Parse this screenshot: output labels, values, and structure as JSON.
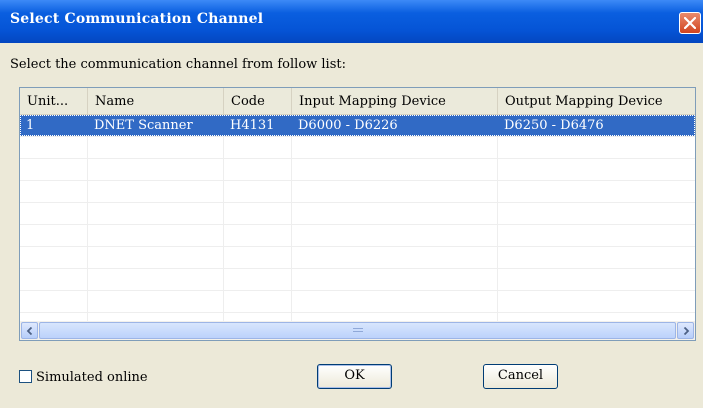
{
  "window": {
    "title": "Select Communication Channel"
  },
  "instruction": "Select the communication channel from follow list:",
  "table": {
    "columns": [
      "Unit...",
      "Name",
      "Code",
      "Input Mapping Device",
      "Output Mapping Device"
    ],
    "rows": [
      [
        "1",
        "DNET Scanner",
        "H4131",
        "D6000 - D6226",
        "D6250 - D6476"
      ]
    ]
  },
  "scrollbar": {
    "thumb_grip": "III"
  },
  "options": {
    "simulated_online_label": "Simulated online",
    "simulated_online_checked": false
  },
  "buttons": {
    "ok_label": "OK",
    "cancel_label": "Cancel"
  },
  "colors": {
    "title_bar": "#0554d6",
    "selection": "#316ac5",
    "dialog_bg": "#ece9d8"
  }
}
